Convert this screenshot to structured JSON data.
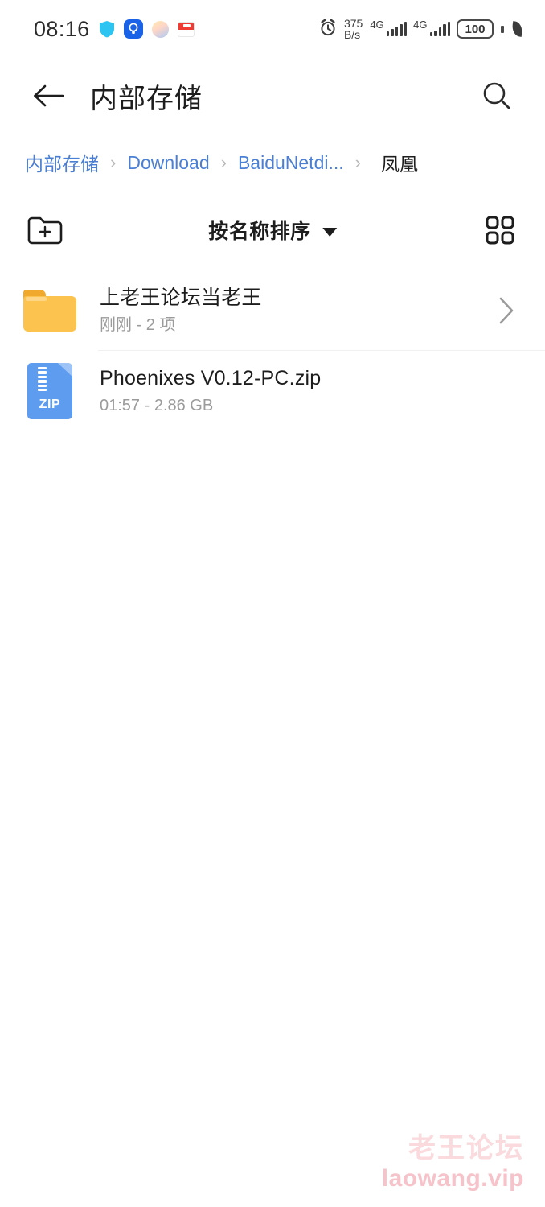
{
  "status_bar": {
    "time": "08:16",
    "left_icons": [
      {
        "name": "shield-icon",
        "label": "shield"
      },
      {
        "name": "lightbulb-icon",
        "label": "lightbulb"
      },
      {
        "name": "gradient-circle-icon",
        "label": "gradient-circle"
      },
      {
        "name": "red-app-icon",
        "label": "red-app"
      }
    ],
    "alarm_icon": "alarm-clock-icon",
    "network_speed_value": "375",
    "network_speed_unit": "B/s",
    "sim1_network": "4G",
    "sim2_network": "4G",
    "battery_level": "100",
    "battery_saver_icon": "leaf-icon"
  },
  "app_bar": {
    "back_icon": "back-arrow-icon",
    "title": "内部存储",
    "search_icon": "search-icon"
  },
  "breadcrumb": {
    "separator": "›",
    "items": [
      {
        "label": "内部存储",
        "current": false
      },
      {
        "label": "Download",
        "current": false
      },
      {
        "label": "BaiduNetdi...",
        "current": false
      },
      {
        "label": "凤凰",
        "current": true
      }
    ]
  },
  "toolbar": {
    "new_folder_icon": "new-folder-icon",
    "sort_label": "按名称排序",
    "sort_caret": "caret-down-icon",
    "grid_view_icon": "grid-view-icon"
  },
  "files": [
    {
      "icon": "folder-icon",
      "type": "folder",
      "name": "上老王论坛当老王",
      "meta": "刚刚 - 2 项",
      "chevron": "chevron-right-icon"
    },
    {
      "icon": "zip-file-icon",
      "type": "zip",
      "icon_label": "ZIP",
      "name": "Phoenixes V0.12-PC.zip",
      "meta": "01:57 - 2.86 GB",
      "chevron": ""
    }
  ],
  "watermark": {
    "line1": "老王论坛",
    "line2": "laowang.vip"
  },
  "colors": {
    "link_blue": "#4a7fd4",
    "folder_yellow": "#fcc34f",
    "zip_blue": "#5e9cf0",
    "watermark_pink": "#fadadd",
    "text_primary": "#1d1d1d",
    "text_secondary": "#9b9b9b"
  }
}
